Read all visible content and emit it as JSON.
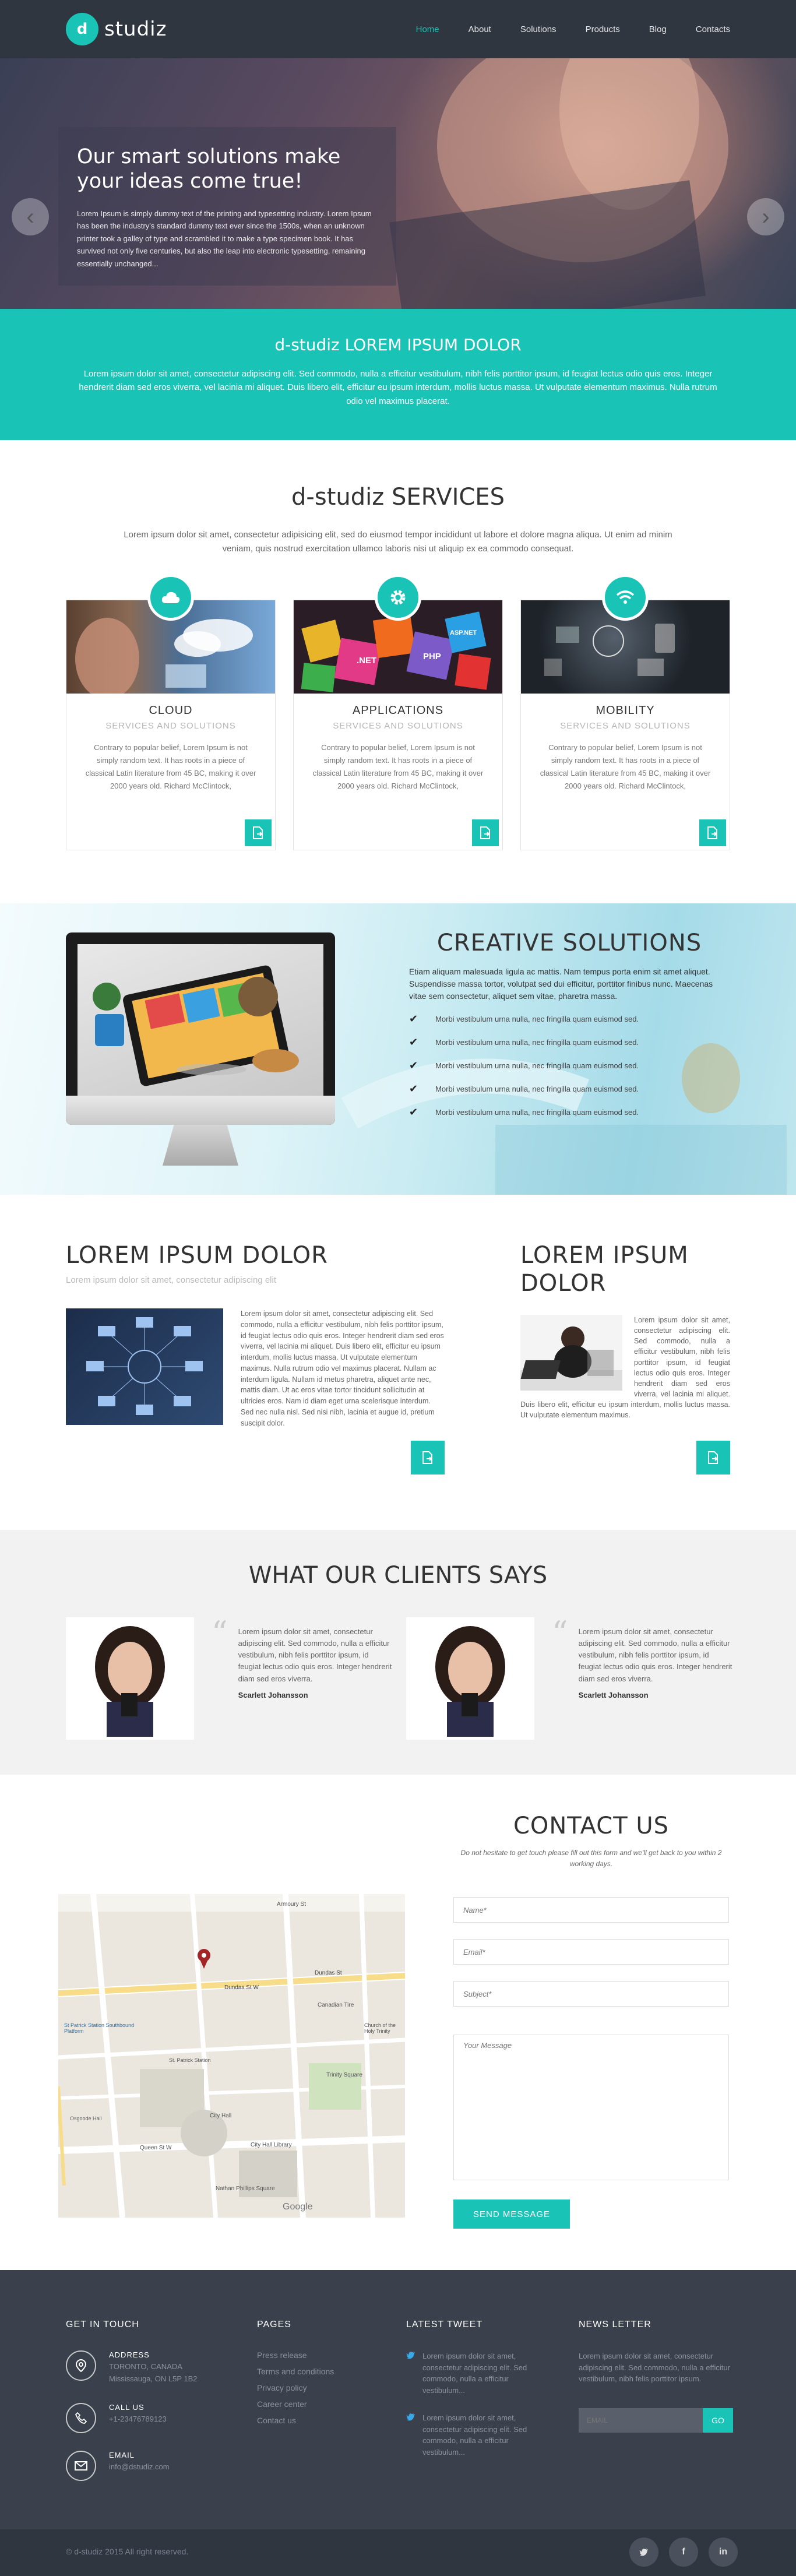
{
  "header": {
    "logo_mark": "d",
    "logo_text": "studiz",
    "nav": [
      "Home",
      "About",
      "Solutions",
      "Products",
      "Blog",
      "Contacts"
    ]
  },
  "hero": {
    "title": "Our smart solutions make your ideas come true!",
    "text": "Lorem Ipsum is simply dummy text of the printing and typesetting industry. Lorem Ipsum has been the industry's standard dummy text ever since the 1500s, when an unknown printer took a galley of type and scrambled it to make a type specimen book. It has survived not only five centuries, but also the leap into electronic typesetting, remaining essentially unchanged...",
    "prev_arrow": "‹",
    "next_arrow": "›"
  },
  "band": {
    "title": "d-studiz LOREM IPSUM DOLOR",
    "text": "Lorem ipsum dolor sit amet, consectetur adipiscing elit. Sed commodo, nulla a efficitur vestibulum, nibh felis porttitor ipsum, id feugiat lectus odio quis eros. Integer hendrerit diam sed eros viverra, vel lacinia mi aliquet. Duis libero elit, efficitur eu ipsum interdum, mollis luctus massa. Ut vulputate elementum maximus. Nulla rutrum odio vel maximus placerat."
  },
  "services": {
    "title": "d-studiz SERVICES",
    "intro": "Lorem ipsum dolor sit amet, consectetur adipisicing elit, sed do eiusmod tempor incididunt ut labore et dolore magna aliqua. Ut enim ad minim veniam, quis nostrud exercitation ullamco laboris nisi ut aliquip ex ea commodo consequat.",
    "cards": [
      {
        "title": "CLOUD",
        "subtitle": "SERVICES AND SOLUTIONS",
        "text": "Contrary to popular belief, Lorem Ipsum is not simply random text. It has roots in a piece of classical Latin literature from 45 BC, making it over 2000 years old. Richard McClintock,",
        "icon": "cloud-icon"
      },
      {
        "title": "APPLICATIONS",
        "subtitle": "SERVICES AND SOLUTIONS",
        "text": "Contrary to popular belief, Lorem Ipsum is not simply random text. It has roots in a piece of classical Latin literature from 45 BC, making it over 2000 years old. Richard McClintock,",
        "icon": "gear-icon"
      },
      {
        "title": "MOBILITY",
        "subtitle": "SERVICES AND SOLUTIONS",
        "text": "Contrary to popular belief, Lorem Ipsum is not simply random text. It has roots in a piece of classical Latin literature from 45 BC, making it over 2000 years old. Richard McClintock,",
        "icon": "wifi-icon"
      }
    ],
    "app_tags": [
      ".NET",
      "PHP",
      "ASP.NET"
    ]
  },
  "creative": {
    "title": "CREATIVE SOLUTIONS",
    "text": "Etiam aliquam malesuada ligula ac mattis. Nam tempus porta enim sit amet aliquet. Suspendisse massa tortor, volutpat sed dui efficitur, porttitor finibus nunc. Maecenas vitae sem consectetur, aliquet sem vitae, pharetra massa.",
    "items": [
      "Morbi vestibulum urna nulla, nec fringilla quam euismod sed.",
      "Morbi vestibulum urna nulla, nec fringilla quam euismod sed.",
      "Morbi vestibulum urna nulla, nec fringilla quam euismod sed.",
      "Morbi vestibulum urna nulla, nec fringilla quam euismod sed.",
      "Morbi vestibulum urna nulla, nec fringilla quam euismod sed."
    ],
    "check": "✔",
    "apple": ""
  },
  "lorem": {
    "left_title": "LOREM IPSUM DOLOR",
    "left_sub": "Lorem ipsum dolor sit amet, consectetur adipiscing elit",
    "left_text": "Lorem ipsum dolor sit amet, consectetur adipiscing elit. Sed commodo, nulla a efficitur vestibulum, nibh felis porttitor ipsum, id feugiat lectus odio quis eros. Integer hendrerit diam sed eros viverra, vel lacinia mi aliquet. Duis libero elit, efficitur eu ipsum interdum, mollis luctus massa. Ut vulputate elementum maximus. Nulla rutrum odio vel maximus placerat. Nullam ac interdum ligula. Nullam id metus pharetra, aliquet ante nec, mattis diam. Ut ac eros vitae tortor tincidunt sollicitudin at ultricies eros. Nam id diam eget urna scelerisque interdum. Sed nec nulla nisl. Sed nisi nibh, lacinia et augue id, pretium suscipit dolor.",
    "right_title": "LOREM IPSUM DOLOR",
    "right_text": "Lorem ipsum dolor sit amet, consectetur adipiscing elit. Sed commodo, nulla a efficitur vestibulum, nibh felis porttitor ipsum, id feugiat lectus odio quis eros. Integer hendrerit diam sed eros viverra, vel lacinia mi aliquet. Duis libero elit, efficitur eu ipsum interdum, mollis luctus massa. Ut vulputate elementum maximus."
  },
  "clients": {
    "title": "WHAT OUR CLIENTS SAYS",
    "quote_mark": "“",
    "items": [
      {
        "text": "Lorem ipsum dolor sit amet, consectetur adipiscing elit. Sed commodo, nulla a efficitur vestibulum, nibh felis porttitor ipsum, id feugiat lectus odio quis eros. Integer hendrerit diam sed eros viverra.",
        "name": "Scarlett Johansson"
      },
      {
        "text": "Lorem ipsum dolor sit amet, consectetur adipiscing elit. Sed commodo, nulla a efficitur vestibulum, nibh felis porttitor ipsum, id feugiat lectus odio quis eros. Integer hendrerit diam sed eros viverra.",
        "name": "Scarlett Johansson"
      }
    ]
  },
  "contact": {
    "title": "CONTACT US",
    "subtitle": "Do not hesitate to get touch please fill out this form and we'll get back to you within 2 working days.",
    "name_placeholder": "Name*",
    "email_placeholder": "Email*",
    "subject_placeholder": "Subject*",
    "message_placeholder": "Your Message",
    "send_label": "SEND MESSAGE",
    "map_labels": {
      "armoury": "Armoury St",
      "dundas_w": "Dundas St W",
      "dundas": "Dundas St",
      "canadian_tire": "Canadian Tire",
      "church": "Church of the Holy Trinity",
      "hospital": "St Patrick Station Southbound Platform",
      "toronto_univ": "St. Patrick Station",
      "osgoode": "Osgoode Hall",
      "queen": "Queen St W",
      "city_hall": "City Hall",
      "library": "City Hall Library",
      "square": "Nathan Phillips Square",
      "trinity": "Trinity Square",
      "google": "Google"
    }
  },
  "footer": {
    "touch_title": "GET IN TOUCH",
    "address_label": "ADDRESS",
    "address_line1": "TORONTO, CANADA",
    "address_line2": "Mississauga, ON L5P 1B2",
    "call_label": "CALL US",
    "call_value": "+1-23476789123",
    "email_label": "EMAIL",
    "email_value": "info@dstudiz.com",
    "pages_title": "PAGES",
    "pages": [
      "Press release",
      "Terms and conditions",
      "Privacy policy",
      "Career center",
      "Contact us"
    ],
    "tweet_title": "LATEST TWEET",
    "tweets": [
      "Lorem ipsum dolor sit amet, consectetur adipiscing elit. Sed commodo, nulla a efficitur vestibulum...",
      "Lorem ipsum dolor sit amet, consectetur adipiscing elit. Sed commodo, nulla a efficitur vestibulum..."
    ],
    "news_title": "NEWS LETTER",
    "news_text": "Lorem ipsum dolor sit amet, consectetur adipiscing elit. Sed commodo, nulla a efficitur vestibulum, nibh felis porttitor ipsum.",
    "email_placeholder": "EMAIL",
    "go_label": "GO",
    "copyright": "© d-studiz 2015 All right reserved.",
    "social": [
      "🐦",
      "f",
      "in"
    ]
  },
  "colors": {
    "accent": "#19c4b6",
    "header_bg": "#2f3640",
    "footer_bg": "#3a414c"
  }
}
